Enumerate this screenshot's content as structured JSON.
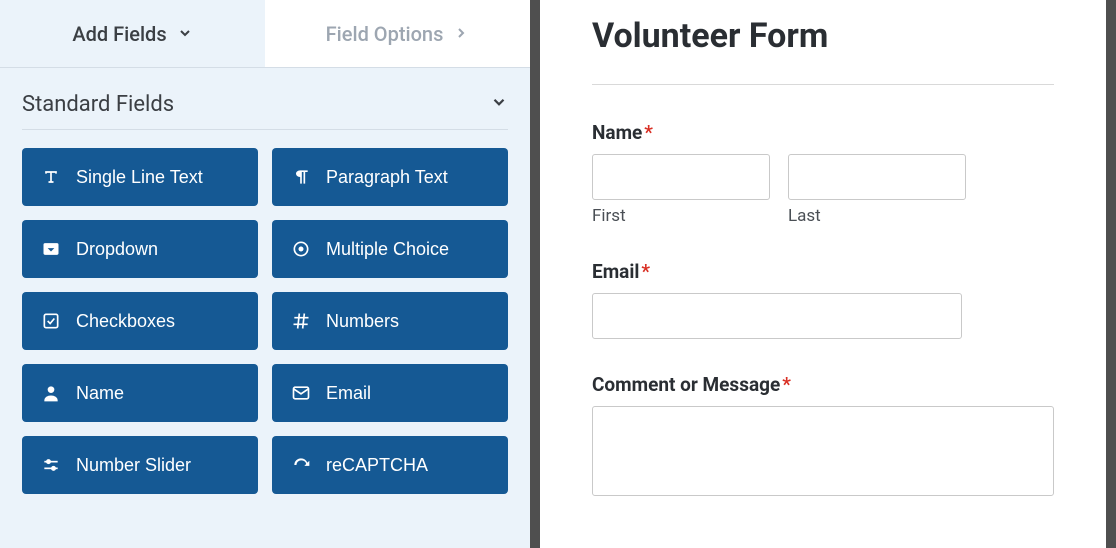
{
  "tabs": {
    "add": "Add Fields",
    "options": "Field Options"
  },
  "section": {
    "title": "Standard Fields"
  },
  "fields": [
    {
      "label": "Single Line Text",
      "icon": "text-icon"
    },
    {
      "label": "Paragraph Text",
      "icon": "paragraph-icon"
    },
    {
      "label": "Dropdown",
      "icon": "dropdown-icon"
    },
    {
      "label": "Multiple Choice",
      "icon": "radio-icon"
    },
    {
      "label": "Checkboxes",
      "icon": "checkbox-icon"
    },
    {
      "label": "Numbers",
      "icon": "hash-icon"
    },
    {
      "label": "Name",
      "icon": "user-icon"
    },
    {
      "label": "Email",
      "icon": "envelope-icon"
    },
    {
      "label": "Number Slider",
      "icon": "sliders-icon"
    },
    {
      "label": "reCAPTCHA",
      "icon": "recaptcha-icon"
    }
  ],
  "form": {
    "title": "Volunteer Form",
    "name": {
      "label": "Name",
      "first": "First",
      "last": "Last"
    },
    "email": {
      "label": "Email"
    },
    "comment": {
      "label": "Comment or Message"
    },
    "required_marker": "*"
  }
}
